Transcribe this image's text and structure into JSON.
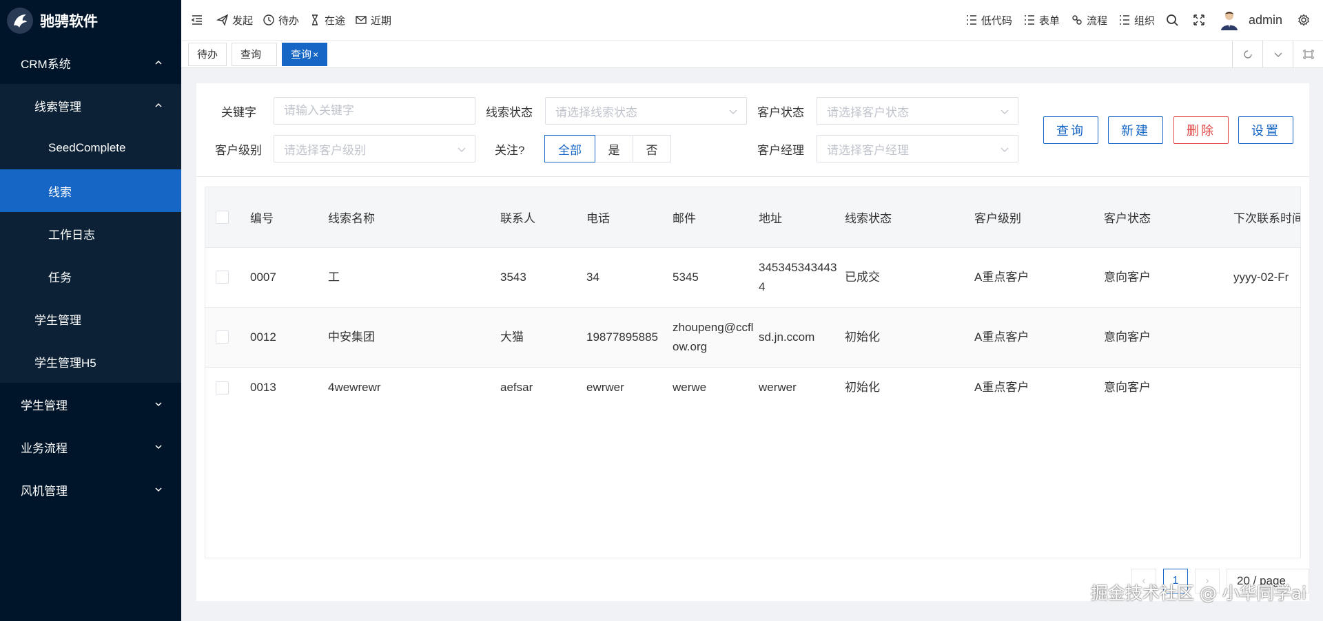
{
  "app": {
    "logo_text": "驰骋软件"
  },
  "sidebar": {
    "crm": "CRM系统",
    "clue_mgmt": "线索管理",
    "items": [
      "SeedComplete",
      "线索",
      "工作日志",
      "任务"
    ],
    "student_mgmt_sub": "学生管理",
    "student_mgmt_h5": "学生管理H5",
    "groups": [
      "学生管理",
      "业务流程",
      "风机管理"
    ]
  },
  "header": {
    "left": [
      "发起",
      "待办",
      "在途",
      "近期"
    ],
    "right": [
      "低代码",
      "表单",
      "流程",
      "组织"
    ],
    "user": "admin"
  },
  "tabs": [
    {
      "label": "待办"
    },
    {
      "label": "查询"
    },
    {
      "label": "查询",
      "close": "×"
    }
  ],
  "filters": {
    "keyword_label": "关键字",
    "keyword_placeholder": "请输入关键字",
    "clue_status_label": "线索状态",
    "clue_status_placeholder": "请选择线索状态",
    "customer_status_label": "客户状态",
    "customer_status_placeholder": "请选择客户状态",
    "customer_level_label": "客户级别",
    "customer_level_placeholder": "请选择客户级别",
    "follow_label": "关注?",
    "follow_options": [
      "全部",
      "是",
      "否"
    ],
    "manager_label": "客户经理",
    "manager_placeholder": "请选择客户经理"
  },
  "buttons": {
    "query": "查询",
    "new": "新建",
    "delete": "删除",
    "settings": "设置"
  },
  "table": {
    "columns": [
      "编号",
      "线索名称",
      "联系人",
      "电话",
      "邮件",
      "地址",
      "线索状态",
      "客户级别",
      "客户状态",
      "下次联系时间"
    ],
    "rows": [
      {
        "id": "0007",
        "name": "工",
        "contact": "3543",
        "phone": "34",
        "email": "5345",
        "address": "3453453434434",
        "status": "已成交",
        "level": "A重点客户",
        "cstatus": "意向客户",
        "next": "yyyy-02-Fr"
      },
      {
        "id": "0012",
        "name": "中安集团",
        "contact": "大猫",
        "phone": "19877895885",
        "email": "zhoupeng@ccflow.org",
        "address": "sd.jn.ccom",
        "status": "初始化",
        "level": "A重点客户",
        "cstatus": "意向客户",
        "next": ""
      },
      {
        "id": "0013",
        "name": "4wewrewr",
        "contact": "aefsar",
        "phone": "ewrwer",
        "email": "werwe",
        "address": "werwer",
        "status": "初始化",
        "level": "A重点客户",
        "cstatus": "意向客户",
        "next": ""
      }
    ]
  },
  "pager": {
    "prev": "‹",
    "current": "1",
    "next": "›",
    "page_size": "20 / page"
  },
  "watermark": "掘金技术社区 @ 小华同学ai",
  "colors": {
    "sidebar_bg": "#001529",
    "active": "#1666c5",
    "danger": "#e04646"
  }
}
